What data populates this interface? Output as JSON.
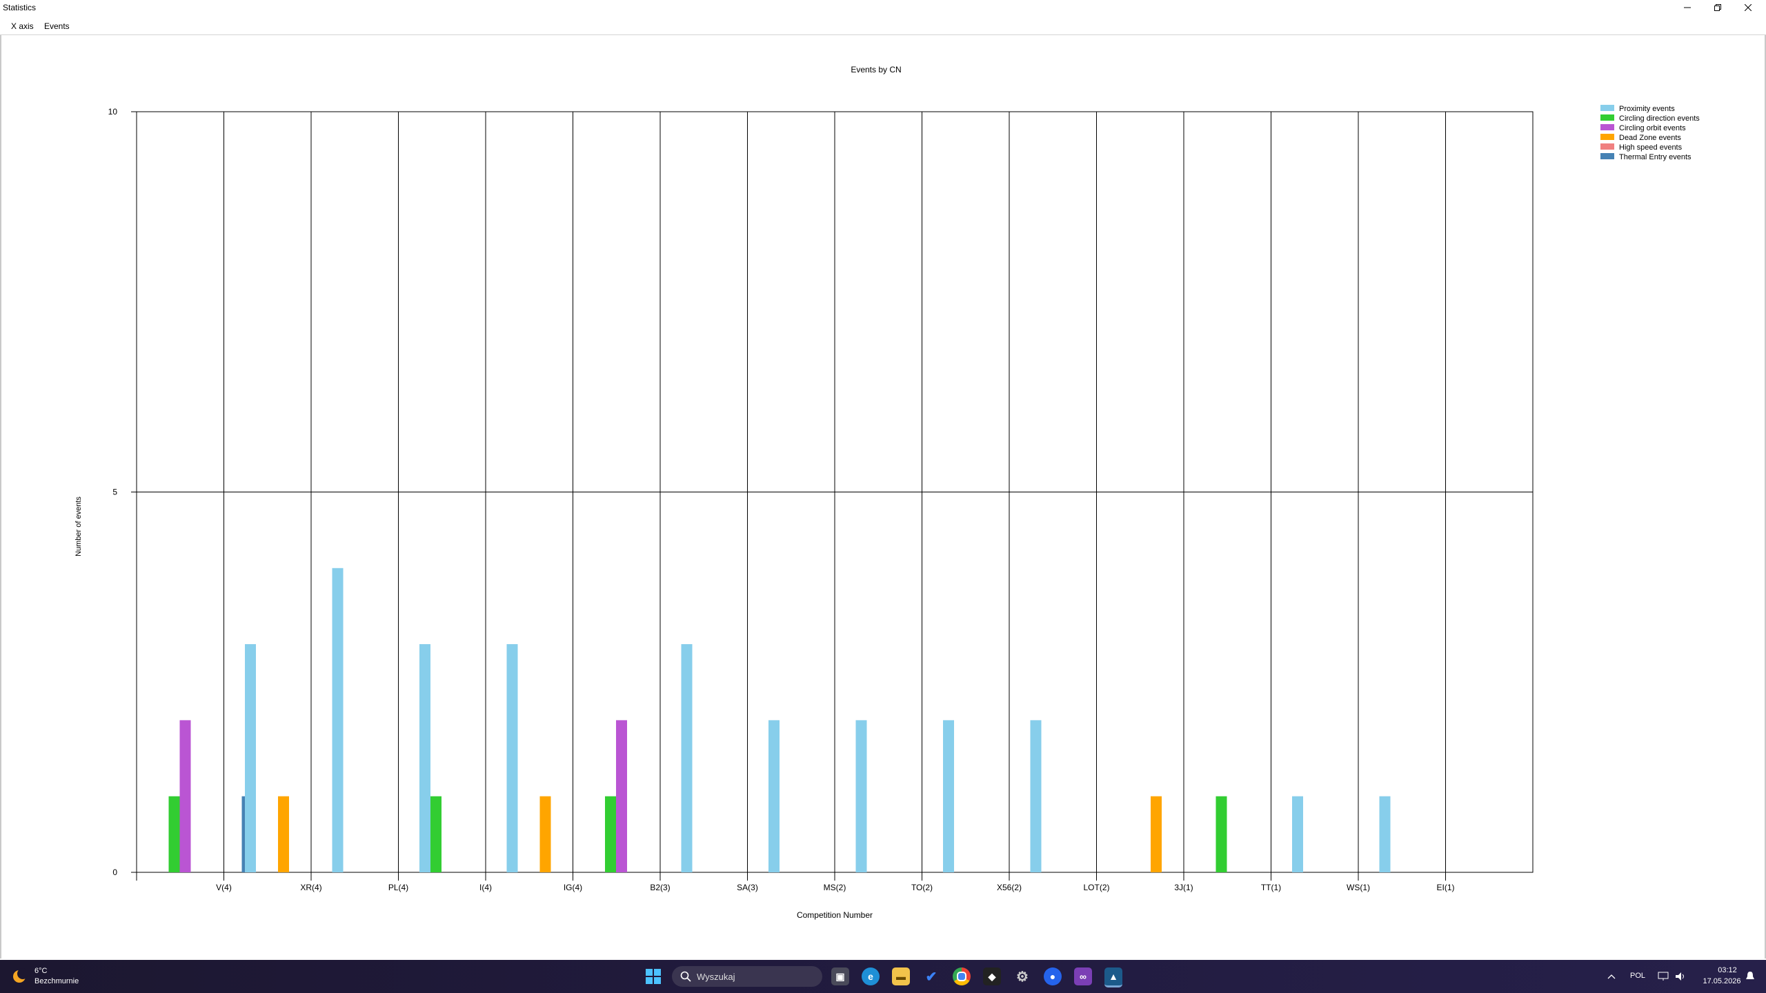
{
  "window": {
    "title": "Statistics"
  },
  "menu": {
    "items": [
      "X axis",
      "Events"
    ]
  },
  "chart_data": {
    "type": "bar",
    "title": "Events by CN",
    "xlabel": "Competition Number",
    "ylabel": "Number of events",
    "ylim": [
      0,
      10
    ],
    "yticks": [
      0,
      5,
      10
    ],
    "grid": true,
    "legend_position": "top-right",
    "categories": [
      "V(4)",
      "XR(4)",
      "PL(4)",
      "I(4)",
      "IG(4)",
      "B2(3)",
      "SA(3)",
      "MS(2)",
      "TO(2)",
      "X56(2)",
      "LOT(2)",
      "3J(1)",
      "TT(1)",
      "WS(1)",
      "EI(1)"
    ],
    "series": [
      {
        "name": "Proximity events",
        "color": "#87ceeb",
        "values": [
          0,
          3,
          4,
          3,
          3,
          0,
          3,
          2,
          2,
          2,
          2,
          0,
          0,
          1,
          1
        ]
      },
      {
        "name": "Circling direction events",
        "color": "#32cd32",
        "values": [
          1,
          0,
          0,
          1,
          0,
          1,
          0,
          0,
          0,
          0,
          0,
          0,
          1,
          0,
          0
        ]
      },
      {
        "name": "Circling orbit events",
        "color": "#ba55d3",
        "values": [
          2,
          0,
          0,
          0,
          0,
          2,
          0,
          0,
          0,
          0,
          0,
          0,
          0,
          0,
          0
        ]
      },
      {
        "name": "Dead Zone events",
        "color": "#ffa500",
        "values": [
          0,
          1,
          0,
          0,
          1,
          0,
          0,
          0,
          0,
          0,
          0,
          1,
          0,
          0,
          0
        ]
      },
      {
        "name": "High speed events",
        "color": "#f08080",
        "values": [
          0,
          0,
          0,
          0,
          0,
          0,
          0,
          0,
          0,
          0,
          0,
          0,
          0,
          0,
          0
        ]
      },
      {
        "name": "Thermal Entry events",
        "color": "#4682b4",
        "values": [
          1,
          0,
          0,
          0,
          0,
          0,
          0,
          0,
          0,
          0,
          0,
          0,
          0,
          0,
          0
        ]
      }
    ]
  },
  "taskbar": {
    "weather": {
      "temp": "6°C",
      "desc": "Bezchmurnie"
    },
    "search_placeholder": "Wyszukaj",
    "language": "POL",
    "time": "03:12",
    "date": "17.05.2026",
    "icons": [
      "start-icon",
      "search-icon",
      "task-view-icon",
      "edge-icon",
      "file-explorer-icon",
      "todo-icon",
      "chrome-icon",
      "app-icon",
      "settings-icon",
      "maps-icon",
      "visual-studio-icon",
      "active-app-icon"
    ]
  }
}
